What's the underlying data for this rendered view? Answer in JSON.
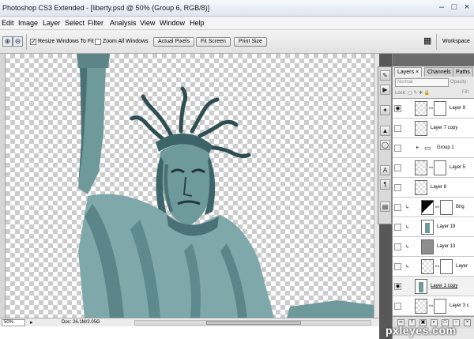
{
  "window": {
    "title": "Photoshop CS3 Extended - [liberty.psd @ 50% (Group 6, RGB/8)]",
    "buttons": [
      "minimize",
      "maximize",
      "close"
    ]
  },
  "menu": [
    "Edit",
    "Image",
    "Layer",
    "Select",
    "Filter",
    "Analysis",
    "View",
    "Window",
    "Help"
  ],
  "options": {
    "resize_windows_to_fit": {
      "label": "Resize Windows To Fit",
      "checked": true
    },
    "zoom_all_windows": {
      "label": "Zoom All Windows",
      "checked": false
    },
    "actual_pixels": "Actual Pixels",
    "fit_screen": "Fit Screen",
    "print_size": "Print Size",
    "workspace": "Workspace"
  },
  "status": {
    "zoom": "50%",
    "doc": "Doc: 26.1M/2.05G"
  },
  "panel": {
    "tabs": [
      "Layers",
      "Channels",
      "Paths"
    ],
    "active_tab": "Layers",
    "blend_mode": "Normal",
    "opacity_label": "Opacity:",
    "lock_label": "Lock:",
    "fill_label": "Fill:"
  },
  "layers": [
    {
      "name": "Layer 9",
      "visible": true,
      "mask": true,
      "linked": true,
      "clipped": false,
      "group": false,
      "selected": false
    },
    {
      "name": "Layer 7 copy",
      "visible": false,
      "mask": false,
      "linked": false,
      "clipped": false,
      "group": false,
      "selected": false
    },
    {
      "name": "Group 1",
      "visible": false,
      "mask": false,
      "linked": false,
      "clipped": false,
      "group": true,
      "selected": false
    },
    {
      "name": "Layer 5",
      "visible": false,
      "mask": true,
      "linked": true,
      "clipped": false,
      "group": false,
      "selected": false
    },
    {
      "name": "Layer 8",
      "visible": false,
      "mask": false,
      "linked": false,
      "clipped": false,
      "group": false,
      "selected": false
    },
    {
      "name": "Brig",
      "visible": false,
      "mask": true,
      "linked": true,
      "clipped": true,
      "group": false,
      "adjustment": true,
      "selected": false
    },
    {
      "name": "Layer 19",
      "visible": false,
      "mask": false,
      "linked": false,
      "clipped": true,
      "group": false,
      "statue_thumb": true,
      "selected": false
    },
    {
      "name": "Layer 13",
      "visible": false,
      "mask": false,
      "linked": false,
      "clipped": true,
      "group": false,
      "gray_thumb": true,
      "selected": false
    },
    {
      "name": "Layer",
      "visible": false,
      "mask": true,
      "linked": true,
      "clipped": true,
      "group": false,
      "selected": false
    },
    {
      "name": "Layer 1 copy",
      "visible": true,
      "mask": false,
      "linked": false,
      "clipped": false,
      "group": false,
      "statue_thumb": true,
      "selected": true
    },
    {
      "name": "Layer 3 c",
      "visible": false,
      "mask": true,
      "linked": true,
      "clipped": false,
      "group": false,
      "selected": false
    }
  ],
  "tools": [
    "history-brush-icon",
    "play-icon",
    "tools-icon",
    "stamp-icon",
    "lasso-icon",
    "text-icon",
    "paragraph-icon",
    "layers-icon"
  ],
  "watermark": "pxleyes.com",
  "colors": {
    "statue": "#6f9a9c",
    "statue_dark": "#2f4e52",
    "panel_dark": "#575757"
  }
}
